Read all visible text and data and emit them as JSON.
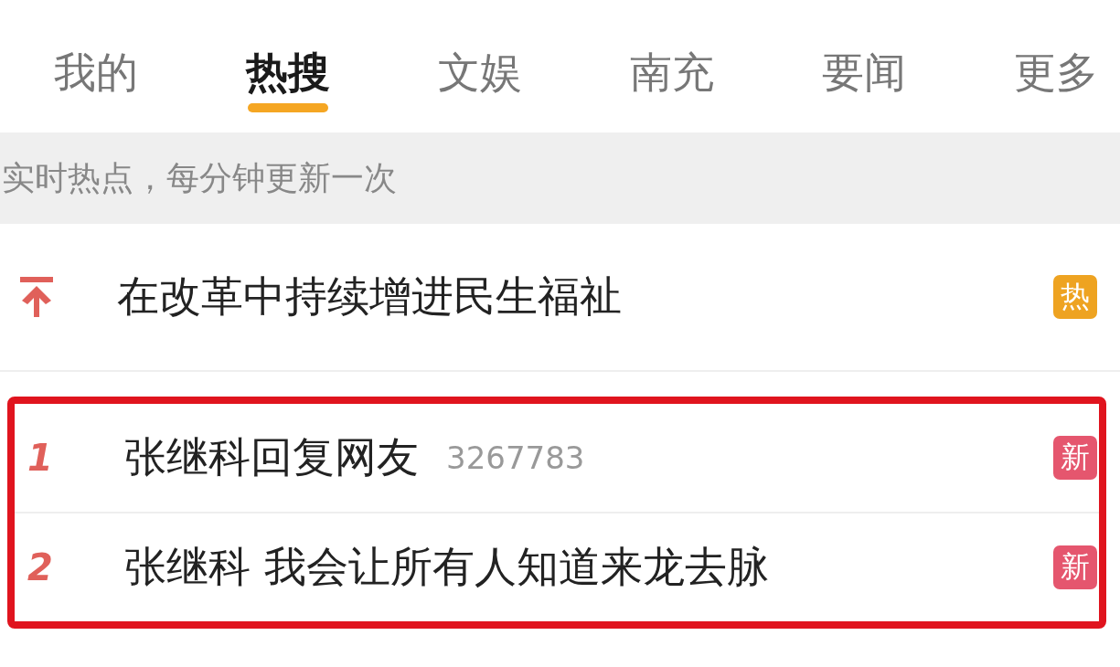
{
  "tabs": [
    {
      "label": "我的",
      "selected": false
    },
    {
      "label": "热搜",
      "selected": true
    },
    {
      "label": "文娱",
      "selected": false
    },
    {
      "label": "南充",
      "selected": false
    },
    {
      "label": "要闻",
      "selected": false
    },
    {
      "label": "更多",
      "selected": false
    }
  ],
  "notice": "实时热点，每分钟更新一次",
  "rows": [
    {
      "kind": "pin",
      "title": "在改革中持续增进民生福祉",
      "badge": {
        "label": "热",
        "color": "#eea321"
      },
      "highlighted": false
    },
    {
      "kind": "number",
      "rank": "1",
      "title": "张继科回复网友",
      "count": "3267783",
      "badge": {
        "label": "新",
        "color": "#e5566e"
      },
      "highlighted": true
    },
    {
      "kind": "number",
      "rank": "2",
      "title": "张继科 我会让所有人知道来龙去脉",
      "badge": {
        "label": "新",
        "color": "#e5566e"
      },
      "highlighted": true
    }
  ]
}
